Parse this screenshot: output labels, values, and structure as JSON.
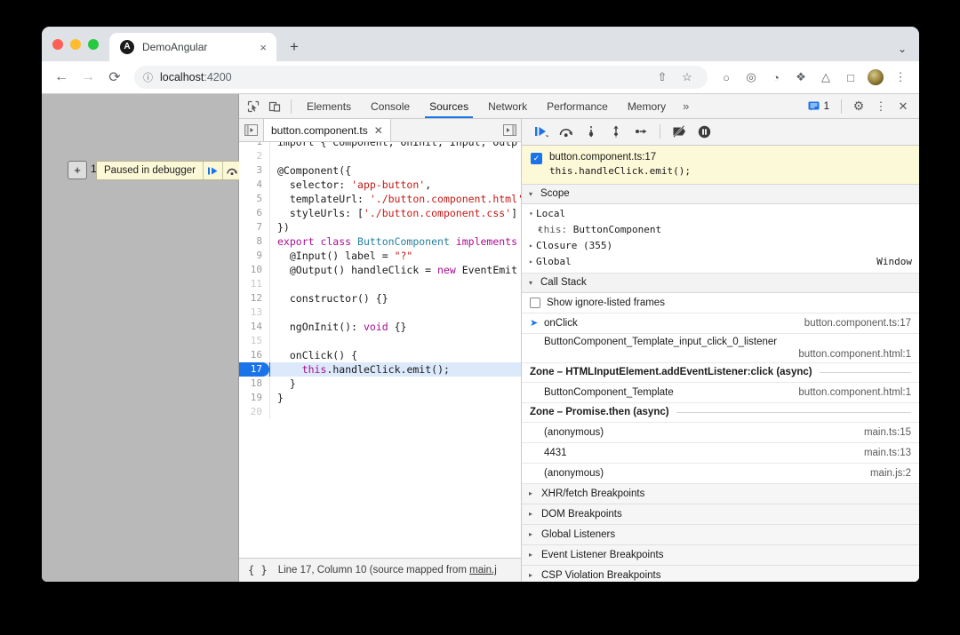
{
  "browser": {
    "tab": {
      "title": "DemoAngular",
      "favicon_letter": "A",
      "close_label": "×"
    },
    "newtab_label": "+",
    "tabstrip_chevron": "⌄",
    "nav": {
      "back": "←",
      "forward": "→",
      "reload": "⟳"
    },
    "omnibox": {
      "info_icon": "ⓘ",
      "host": "localhost",
      "port": ":4200"
    },
    "toolbar_icons": [
      {
        "name": "share-icon",
        "glyph": "⇧"
      },
      {
        "name": "bookmark-star-icon",
        "glyph": "☆"
      },
      {
        "name": "ghost-extension-icon",
        "glyph": "○"
      },
      {
        "name": "incognito-extension-icon",
        "glyph": "◎"
      },
      {
        "name": "privacy-extension-icon",
        "glyph": "◔"
      },
      {
        "name": "puzzle-extensions-icon",
        "glyph": "❖"
      },
      {
        "name": "flask-extension-icon",
        "glyph": "△"
      },
      {
        "name": "sidepanel-icon",
        "glyph": "□"
      }
    ],
    "menu_icon": "⋮"
  },
  "page": {
    "button_label": "+",
    "counter": "1",
    "paused_text": "Paused in debugger",
    "resume_glyph": "▶",
    "step_glyph": "⤵"
  },
  "devtools": {
    "inspect_icon": "↖",
    "device_icon": "▭",
    "tabs": [
      {
        "label": "Elements",
        "active": false
      },
      {
        "label": "Console",
        "active": false
      },
      {
        "label": "Sources",
        "active": true
      },
      {
        "label": "Network",
        "active": false
      },
      {
        "label": "Performance",
        "active": false
      },
      {
        "label": "Memory",
        "active": false
      }
    ],
    "overflow_label": "»",
    "message_count": "1",
    "settings_icon": "⚙",
    "kebab_icon": "⋮",
    "close_icon": "✕",
    "accent_color": "#1a73e8"
  },
  "editor": {
    "panel_toggle_left": "▶",
    "panel_toggle_right": "▶",
    "file_tab": {
      "name": "button.component.ts",
      "close": "✕"
    },
    "lines": [
      {
        "num": "1",
        "cut": true,
        "segments": [
          {
            "t": "import { Component, OnInit, Input, Outp",
            "c": "k-plain"
          }
        ]
      },
      {
        "num": "2",
        "segments": []
      },
      {
        "num": "3",
        "segments": [
          {
            "t": "@Component({",
            "c": "k-plain"
          }
        ]
      },
      {
        "num": "4",
        "segments": [
          {
            "t": "  selector: ",
            "c": "k-plain"
          },
          {
            "t": "'app-button'",
            "c": "k-str"
          },
          {
            "t": ",",
            "c": "k-plain"
          }
        ]
      },
      {
        "num": "5",
        "segments": [
          {
            "t": "  templateUrl: ",
            "c": "k-plain"
          },
          {
            "t": "'./button.component.html'",
            "c": "k-str"
          }
        ]
      },
      {
        "num": "6",
        "segments": [
          {
            "t": "  styleUrls: [",
            "c": "k-plain"
          },
          {
            "t": "'./button.component.css'",
            "c": "k-str"
          },
          {
            "t": "]",
            "c": "k-plain"
          }
        ]
      },
      {
        "num": "7",
        "segments": [
          {
            "t": "})",
            "c": "k-plain"
          }
        ]
      },
      {
        "num": "8",
        "segments": [
          {
            "t": "export class ",
            "c": "k-kw"
          },
          {
            "t": "ButtonComponent",
            "c": "k-type"
          },
          {
            "t": " implements",
            "c": "k-kw"
          }
        ]
      },
      {
        "num": "9",
        "segments": [
          {
            "t": "  @Input() label = ",
            "c": "k-plain"
          },
          {
            "t": "\"?\"",
            "c": "k-str"
          }
        ]
      },
      {
        "num": "10",
        "segments": [
          {
            "t": "  @Output() handleClick = ",
            "c": "k-plain"
          },
          {
            "t": "new",
            "c": "k-kw"
          },
          {
            "t": " EventEmit",
            "c": "k-plain"
          }
        ]
      },
      {
        "num": "11",
        "segments": []
      },
      {
        "num": "12",
        "segments": [
          {
            "t": "  constructor() {}",
            "c": "k-plain"
          }
        ]
      },
      {
        "num": "13",
        "segments": []
      },
      {
        "num": "14",
        "segments": [
          {
            "t": "  ngOnInit(): ",
            "c": "k-plain"
          },
          {
            "t": "void",
            "c": "k-kw"
          },
          {
            "t": " {}",
            "c": "k-plain"
          }
        ]
      },
      {
        "num": "15",
        "segments": []
      },
      {
        "num": "16",
        "segments": [
          {
            "t": "  onClick() {",
            "c": "k-plain"
          }
        ]
      },
      {
        "num": "17",
        "exec": true,
        "segments": [
          {
            "t": "    ",
            "c": "k-plain"
          },
          {
            "t": "this",
            "c": "k-this"
          },
          {
            "t": ".",
            "c": "k-plain"
          },
          {
            "t": "handleClick",
            "c": "k-plain"
          },
          {
            "t": ".",
            "c": "k-plain"
          },
          {
            "t": "emit();",
            "c": "k-plain"
          }
        ]
      },
      {
        "num": "18",
        "segments": [
          {
            "t": "  }",
            "c": "k-plain"
          }
        ]
      },
      {
        "num": "19",
        "segments": [
          {
            "t": "}",
            "c": "k-plain"
          }
        ]
      },
      {
        "num": "20",
        "segments": []
      }
    ],
    "status": {
      "braces": "{ }",
      "text": "Line 17, Column 10 (source mapped from ",
      "link": "main.j"
    }
  },
  "debugger": {
    "controls": [
      {
        "name": "resume-button",
        "glyph": "▶",
        "accent": true
      },
      {
        "name": "step-over-button",
        "glyph": "⤵"
      },
      {
        "name": "step-into-button",
        "glyph": "↓"
      },
      {
        "name": "step-out-button",
        "glyph": "↑"
      },
      {
        "name": "step-button",
        "glyph": "→"
      },
      {
        "name": "deactivate-breakpoints-button",
        "glyph": "⊘"
      },
      {
        "name": "pause-on-exceptions-button",
        "glyph": "⏸"
      }
    ],
    "breakpoint_banner": {
      "checked": true,
      "check_glyph": "✓",
      "location": "button.component.ts:17",
      "code": "this.handleClick.emit();"
    },
    "scope": {
      "title": "Scope",
      "groups": [
        {
          "label": "Local",
          "expanded": true,
          "tri": "▾",
          "children": [
            {
              "tri": "▸",
              "name": "this:",
              "value": "ButtonComponent"
            }
          ]
        },
        {
          "label": "Closure (355)",
          "expanded": false,
          "tri": "▸",
          "children": []
        },
        {
          "label": "Global",
          "expanded": false,
          "tri": "▸",
          "right": "Window",
          "children": []
        }
      ]
    },
    "call_stack": {
      "title": "Call Stack",
      "ignore_listed_label": "Show ignore-listed frames",
      "ignore_listed_checked": false,
      "frames": [
        {
          "type": "frame",
          "active": true,
          "name": "onClick",
          "location": "button.component.ts:17",
          "wrap": false
        },
        {
          "type": "frame",
          "active": false,
          "name": "ButtonComponent_Template_input_click_0_listener",
          "location": "button.component.html:1",
          "wrap": true
        },
        {
          "type": "async",
          "label": "Zone – HTMLInputElement.addEventListener:click (async)"
        },
        {
          "type": "frame",
          "active": false,
          "name": "ButtonComponent_Template",
          "location": "button.component.html:1",
          "wrap": false
        },
        {
          "type": "async",
          "label": "Zone – Promise.then (async)"
        },
        {
          "type": "frame",
          "active": false,
          "name": "(anonymous)",
          "location": "main.ts:15",
          "wrap": false
        },
        {
          "type": "frame",
          "active": false,
          "name": "4431",
          "location": "main.ts:13",
          "wrap": false
        },
        {
          "type": "frame",
          "active": false,
          "name": "(anonymous)",
          "location": "main.js:2",
          "wrap": false
        }
      ]
    },
    "breakpoint_sections": [
      {
        "label": "XHR/fetch Breakpoints",
        "tri": "▸"
      },
      {
        "label": "DOM Breakpoints",
        "tri": "▸"
      },
      {
        "label": "Global Listeners",
        "tri": "▸"
      },
      {
        "label": "Event Listener Breakpoints",
        "tri": "▸"
      },
      {
        "label": "CSP Violation Breakpoints",
        "tri": "▸"
      }
    ]
  }
}
